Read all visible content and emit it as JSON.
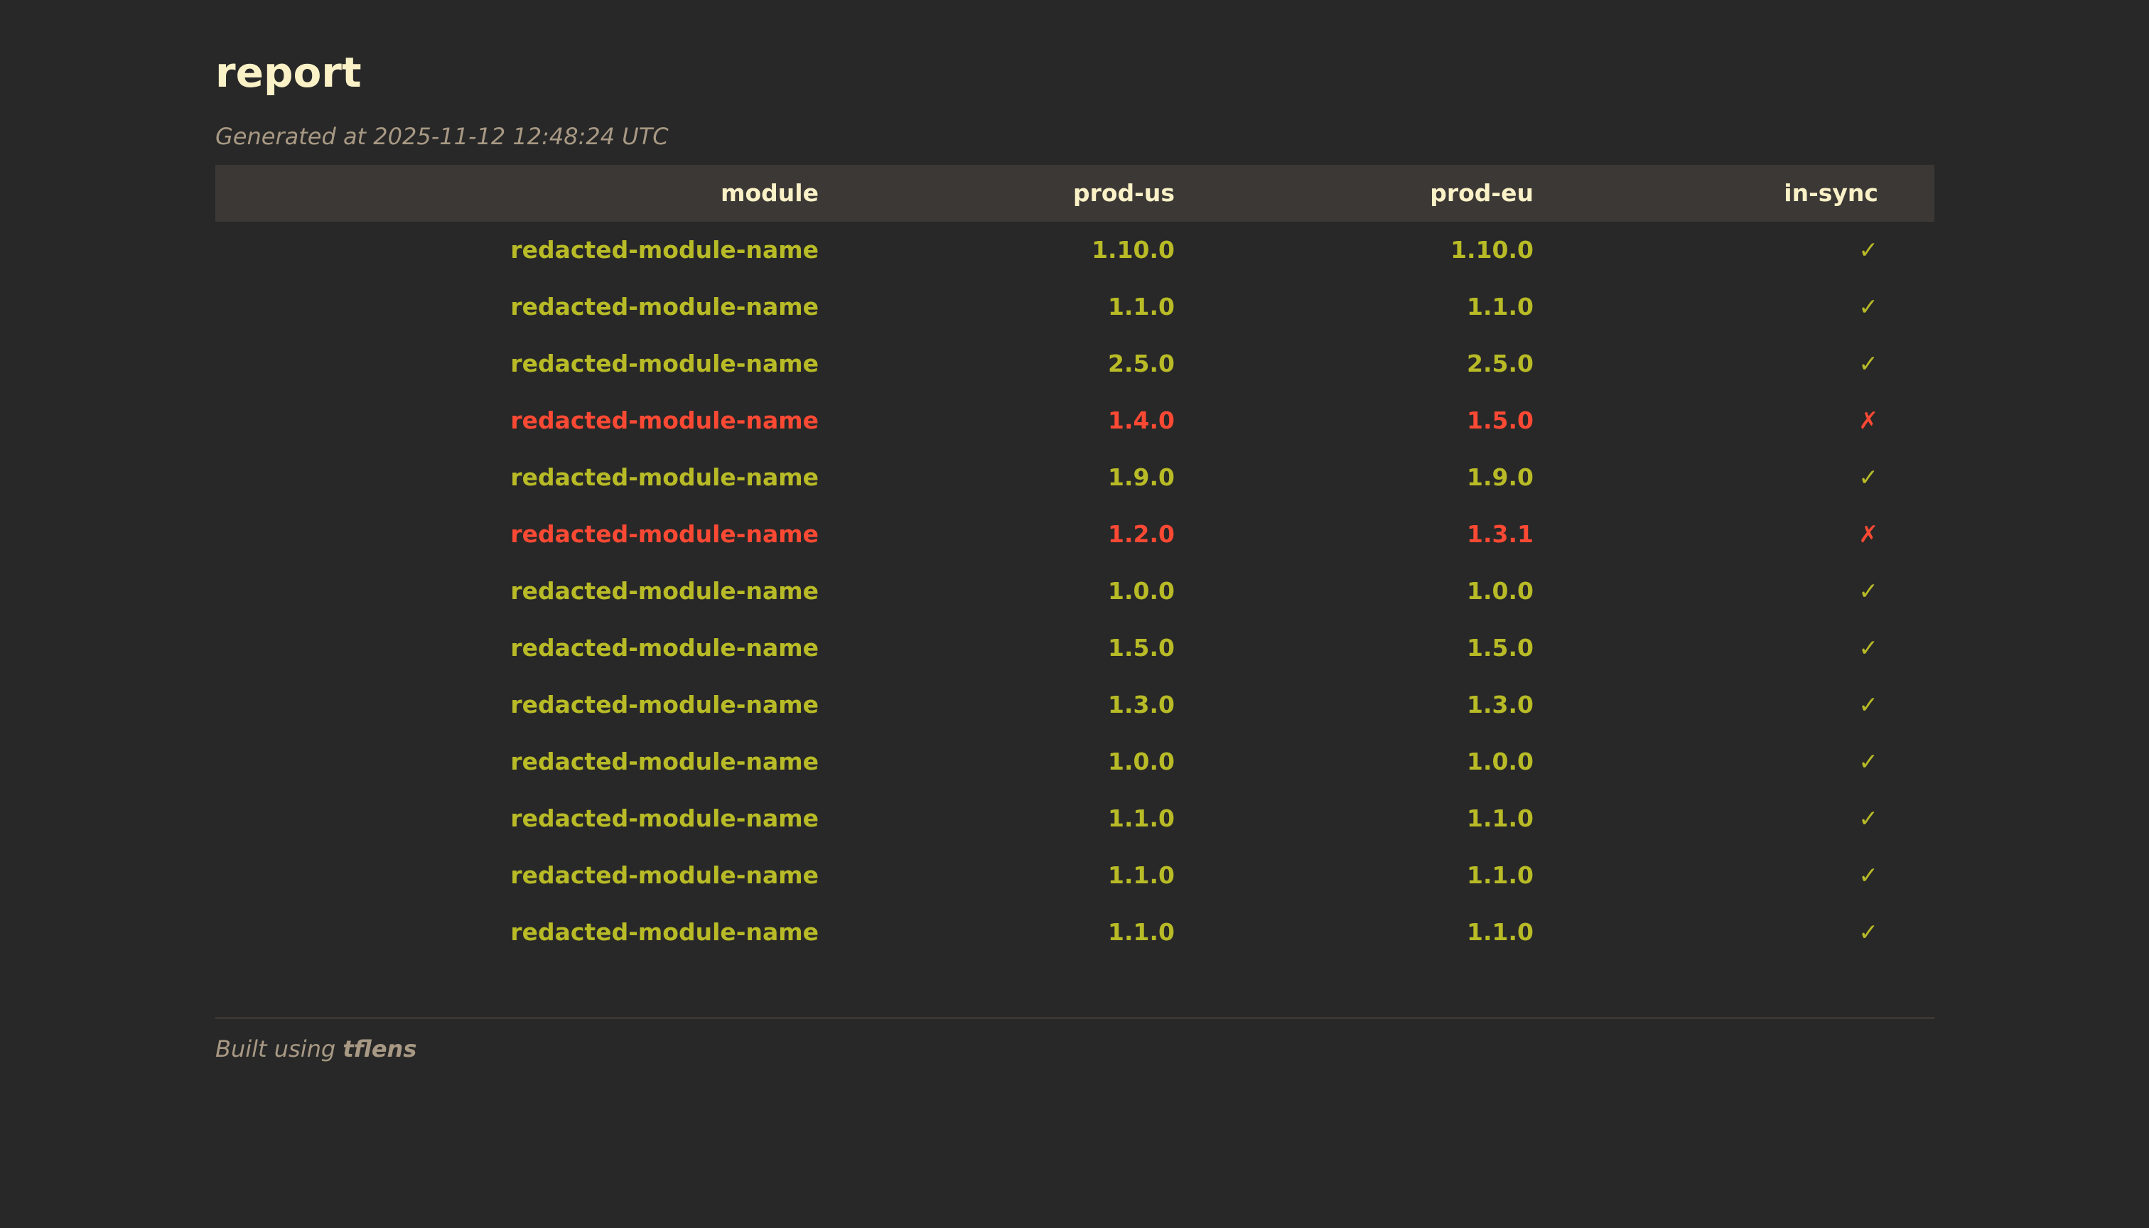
{
  "header": {
    "title": "report",
    "generated": "Generated at 2025-11-12 12:48:24 UTC"
  },
  "table": {
    "columns": [
      "module",
      "prod-us",
      "prod-eu",
      "in-sync"
    ],
    "rows": [
      {
        "module": "redacted-module-name",
        "prod_us": "1.10.0",
        "prod_eu": "1.10.0",
        "in_sync": "✓",
        "status": "ok"
      },
      {
        "module": "redacted-module-name",
        "prod_us": "1.1.0",
        "prod_eu": "1.1.0",
        "in_sync": "✓",
        "status": "ok"
      },
      {
        "module": "redacted-module-name",
        "prod_us": "2.5.0",
        "prod_eu": "2.5.0",
        "in_sync": "✓",
        "status": "ok"
      },
      {
        "module": "redacted-module-name",
        "prod_us": "1.4.0",
        "prod_eu": "1.5.0",
        "in_sync": "✗",
        "status": "bad"
      },
      {
        "module": "redacted-module-name",
        "prod_us": "1.9.0",
        "prod_eu": "1.9.0",
        "in_sync": "✓",
        "status": "ok"
      },
      {
        "module": "redacted-module-name",
        "prod_us": "1.2.0",
        "prod_eu": "1.3.1",
        "in_sync": "✗",
        "status": "bad"
      },
      {
        "module": "redacted-module-name",
        "prod_us": "1.0.0",
        "prod_eu": "1.0.0",
        "in_sync": "✓",
        "status": "ok"
      },
      {
        "module": "redacted-module-name",
        "prod_us": "1.5.0",
        "prod_eu": "1.5.0",
        "in_sync": "✓",
        "status": "ok"
      },
      {
        "module": "redacted-module-name",
        "prod_us": "1.3.0",
        "prod_eu": "1.3.0",
        "in_sync": "✓",
        "status": "ok"
      },
      {
        "module": "redacted-module-name",
        "prod_us": "1.0.0",
        "prod_eu": "1.0.0",
        "in_sync": "✓",
        "status": "ok"
      },
      {
        "module": "redacted-module-name",
        "prod_us": "1.1.0",
        "prod_eu": "1.1.0",
        "in_sync": "✓",
        "status": "ok"
      },
      {
        "module": "redacted-module-name",
        "prod_us": "1.1.0",
        "prod_eu": "1.1.0",
        "in_sync": "✓",
        "status": "ok"
      },
      {
        "module": "redacted-module-name",
        "prod_us": "1.1.0",
        "prod_eu": "1.1.0",
        "in_sync": "✓",
        "status": "ok"
      }
    ]
  },
  "footer": {
    "prefix": "Built using",
    "tool": "tflens"
  },
  "colors": {
    "background": "#282828",
    "header_bg": "#3c3836",
    "in_sync": "#b8bb26",
    "out_of_sync": "#fb4934",
    "title": "#fbf1c7",
    "muted": "#a89984"
  }
}
